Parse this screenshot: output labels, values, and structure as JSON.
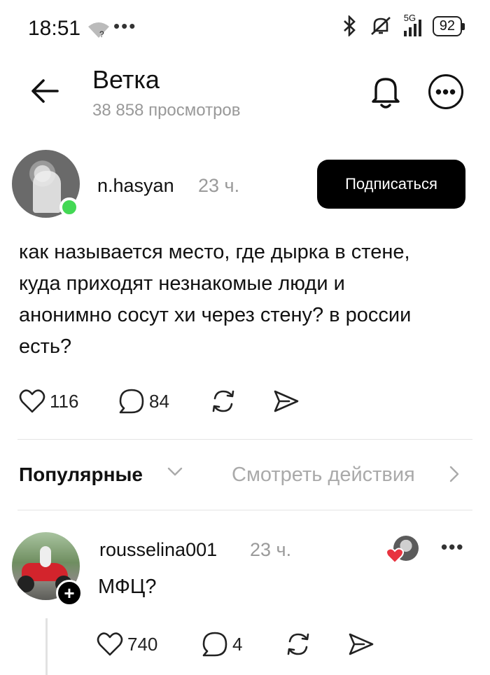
{
  "status_bar": {
    "time": "18:51",
    "network": "5G",
    "battery": "92"
  },
  "header": {
    "title": "Ветка",
    "views": "38 858 просмотров"
  },
  "post": {
    "username": "n.hasyan",
    "time": "23 ч.",
    "follow_label": "Подписаться",
    "text": "как называется место, где дырка в стене, куда приходят незнакомые люди и анонимно сосут хи через стену? в россии есть?",
    "likes": "116",
    "comments": "84"
  },
  "sort_bar": {
    "sort_label": "Популярные",
    "view_actions_label": "Смотреть действия"
  },
  "comment": {
    "username": "rousselina001",
    "time": "23 ч.",
    "text": "МФЦ?",
    "likes": "740",
    "replies": "4"
  },
  "colors": {
    "online": "#43d854",
    "heart": "#e8333f",
    "muted": "#9a9a9a"
  },
  "icons": [
    "wifi-icon",
    "bluetooth-icon",
    "mute-icon",
    "signal-icon",
    "battery-icon",
    "back-arrow-icon",
    "bell-icon",
    "more-icon",
    "heart-icon",
    "comment-icon",
    "repost-icon",
    "share-icon",
    "chevron-down-icon",
    "chevron-right-icon",
    "plus-icon"
  ]
}
